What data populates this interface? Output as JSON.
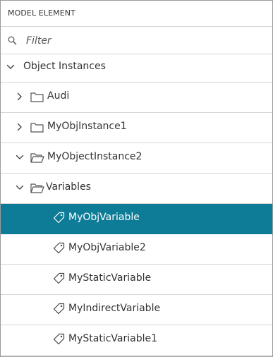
{
  "panel": {
    "header_label": "MODEL ELEMENT",
    "filter_placeholder": "Filter",
    "filter_value": ""
  },
  "tree": [
    {
      "label": "Object Instances",
      "depth": 0,
      "expanded": true,
      "icon": "none",
      "chevron": "chevron-down-icon"
    },
    {
      "label": "Audi",
      "depth": 1,
      "expanded": false,
      "icon": "folder-icon",
      "chevron": "chevron-right-icon"
    },
    {
      "label": "MyObjInstance1",
      "depth": 1,
      "expanded": false,
      "icon": "folder-icon",
      "chevron": "chevron-right-icon"
    },
    {
      "label": "MyObjectInstance2",
      "depth": 1,
      "expanded": true,
      "icon": "folder-open-icon",
      "chevron": "chevron-down-icon"
    },
    {
      "label": "Variables",
      "depth": 2,
      "expanded": true,
      "icon": "folder-open-icon",
      "chevron": "chevron-down-icon"
    },
    {
      "label": "MyObjVariable",
      "depth": 3,
      "selected": true,
      "icon": "tag-icon"
    },
    {
      "label": "MyObjVariable2",
      "depth": 3,
      "icon": "tag-icon"
    },
    {
      "label": "MyStaticVariable",
      "depth": 3,
      "icon": "tag-icon"
    },
    {
      "label": "MyIndirectVariable",
      "depth": 3,
      "icon": "tag-icon"
    },
    {
      "label": "MyStaticVariable1",
      "depth": 3,
      "icon": "tag-icon"
    }
  ],
  "colors": {
    "selected_background": "#0f7c97",
    "selected_text": "#ffffff",
    "text": "#333333",
    "divider": "#d6d6d6"
  }
}
